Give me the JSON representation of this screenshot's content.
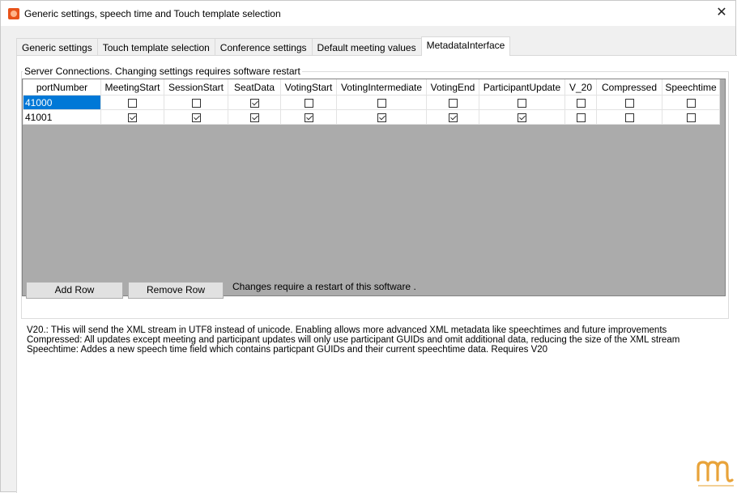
{
  "window": {
    "title": "Generic settings, speech time and Touch template selection",
    "close_label": "✕"
  },
  "tabs": [
    {
      "label": "Generic settings",
      "active": false
    },
    {
      "label": "Touch template selection",
      "active": false
    },
    {
      "label": "Conference settings",
      "active": false
    },
    {
      "label": "Default meeting values",
      "active": false
    },
    {
      "label": "MetadataInterface",
      "active": true
    }
  ],
  "group": {
    "legend": "Server Connections. Changing settings requires software restart"
  },
  "grid": {
    "columns": [
      "portNumber",
      "MeetingStart",
      "SessionStart",
      "SeatData",
      "VotingStart",
      "VotingIntermediate",
      "VotingEnd",
      "ParticipantUpdate",
      "V_20",
      "Compressed",
      "Speechtime"
    ],
    "rows": [
      {
        "port": "41000",
        "selected": true,
        "checks": [
          false,
          false,
          true,
          false,
          false,
          false,
          false,
          false,
          false,
          false
        ]
      },
      {
        "port": "41001",
        "selected": false,
        "checks": [
          true,
          true,
          true,
          true,
          true,
          true,
          true,
          false,
          false,
          false
        ]
      }
    ]
  },
  "buttons": {
    "add_row": "Add Row",
    "remove_row": "Remove Row"
  },
  "restart_note": "Changes require a restart of this software .",
  "info_lines": [
    "V20.: THis will send the XML stream in UTF8 instead of unicode. Enabling allows more advanced XML metadata like speechtimes and future improvements",
    "Compressed: All updates except meeting and participant updates will only use participant GUIDs and omit additional data, reducing the size of the XML stream",
    "Speechtime: Addes a new speech time field which contains particpant GUIDs and their current speechtime data. Requires V20"
  ],
  "colors": {
    "selection": "#0078d7",
    "grid_background": "#ababab",
    "logo": "#e8a33a"
  },
  "icons": {
    "app": "app-icon",
    "close": "close-icon",
    "logo": "brand-logo-icon"
  }
}
